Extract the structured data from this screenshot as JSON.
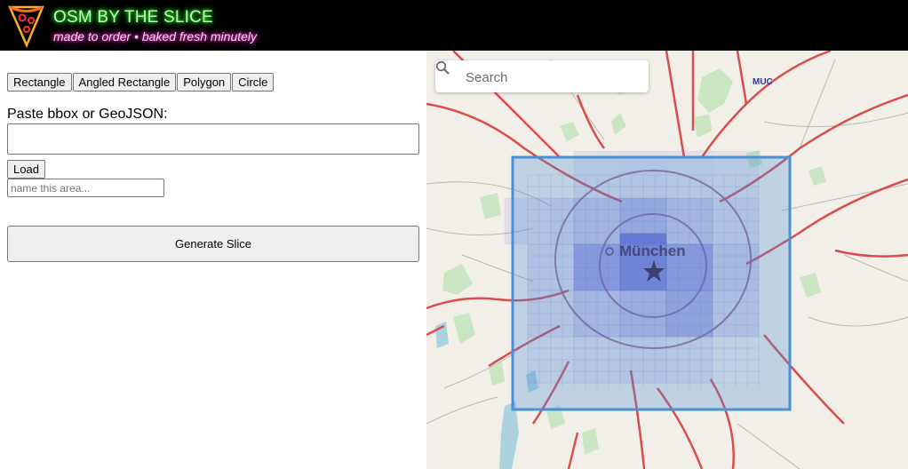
{
  "header": {
    "title": "OSM BY THE SLICE",
    "tagline": "made to order • baked fresh minutely",
    "logo_icon": "pizza-slice-icon"
  },
  "toolbar": {
    "shape_buttons": [
      "Rectangle",
      "Angled Rectangle",
      "Polygon",
      "Circle"
    ]
  },
  "paste": {
    "label": "Paste bbox or GeoJSON:",
    "value": "",
    "load_label": "Load"
  },
  "name_field": {
    "placeholder": "name this area...",
    "value": ""
  },
  "generate": {
    "label": "Generate Slice"
  },
  "map": {
    "search_placeholder": "Search",
    "search_icon": "magnifier-icon",
    "city_label": "München",
    "city_marker_icon": "star-icon",
    "airport_label": "MUC",
    "selection_color": "#4a90d9",
    "tile_color": "#6f4ed0"
  },
  "colors": {
    "title_glow": "#3aff3a",
    "tagline_glow": "#ff2fd0",
    "header_bg": "#000000",
    "road_major": "#d94d4d",
    "water": "#aad3df",
    "park": "#c8e6c0"
  }
}
